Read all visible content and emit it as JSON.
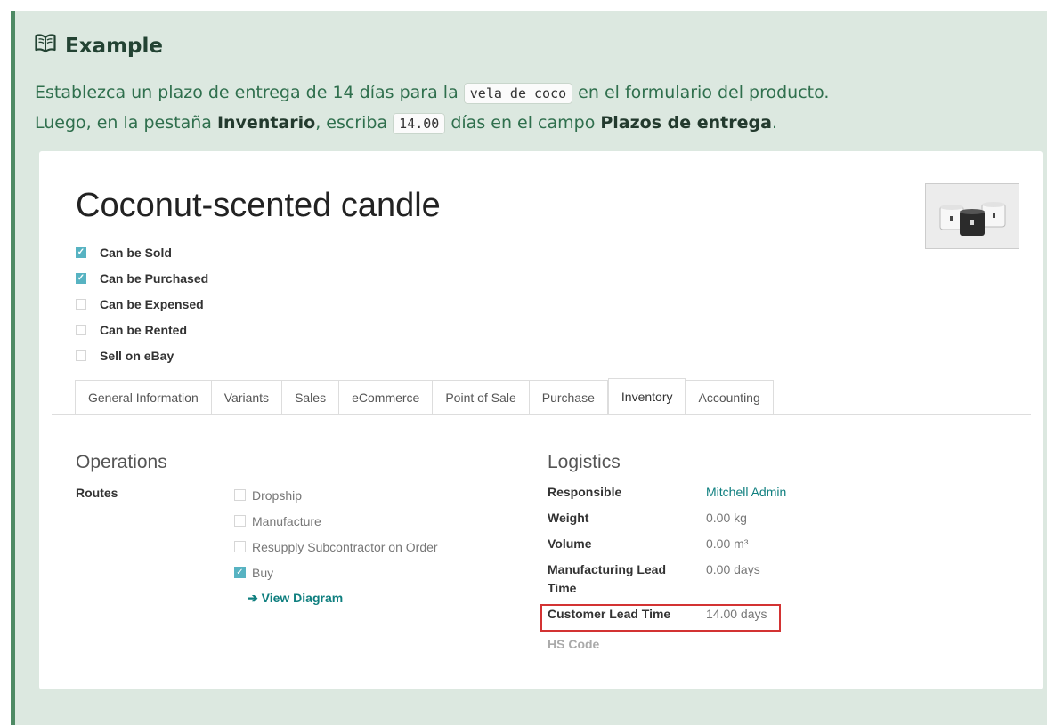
{
  "admonition": {
    "icon": "book-open-icon",
    "title": "Example",
    "line1": {
      "before": "Establezca un plazo de entrega de 14 días para la ",
      "code": "vela de coco",
      "after": " en el formulario del producto."
    },
    "line2": {
      "before": "Luego, en la pestaña ",
      "bold1": "Inventario",
      "mid": ", escriba ",
      "code": "14.00",
      "mid2": " días en el campo ",
      "bold2": "Plazos de entrega",
      "end": "."
    }
  },
  "product": {
    "title": "Coconut-scented candle",
    "image": "candle-product-image",
    "checkboxes": [
      {
        "label": "Can be Sold",
        "checked": true
      },
      {
        "label": "Can be Purchased",
        "checked": true
      },
      {
        "label": "Can be Expensed",
        "checked": false
      },
      {
        "label": "Can be Rented",
        "checked": false
      },
      {
        "label": "Sell on eBay",
        "checked": false
      }
    ]
  },
  "tabs": [
    {
      "label": "General Information",
      "active": false
    },
    {
      "label": "Variants",
      "active": false
    },
    {
      "label": "Sales",
      "active": false
    },
    {
      "label": "eCommerce",
      "active": false
    },
    {
      "label": "Point of Sale",
      "active": false
    },
    {
      "label": "Purchase",
      "active": false
    },
    {
      "label": "Inventory",
      "active": true
    },
    {
      "label": "Accounting",
      "active": false
    }
  ],
  "operations": {
    "title": "Operations",
    "routes_label": "Routes",
    "routes": [
      {
        "label": "Dropship",
        "checked": false
      },
      {
        "label": "Manufacture",
        "checked": false
      },
      {
        "label": "Resupply Subcontractor on Order",
        "checked": false
      },
      {
        "label": "Buy",
        "checked": true
      }
    ],
    "view_diagram": "➔ View Diagram"
  },
  "logistics": {
    "title": "Logistics",
    "responsible_label": "Responsible",
    "responsible_value": "Mitchell Admin",
    "weight_label": "Weight",
    "weight_value": "0.00 kg",
    "volume_label": "Volume",
    "volume_value": "0.00 m³",
    "mfg_label": "Manufacturing Lead Time",
    "mfg_value": "0.00 days",
    "customer_label": "Customer Lead Time",
    "customer_value": "14.00 days",
    "hs_label": "HS Code"
  },
  "colors": {
    "admonition_bg": "#dce8e0",
    "admonition_border": "#4e8a64",
    "checkbox_checked": "#57b3c2",
    "link": "#0f7f7f",
    "highlight": "#d33333"
  }
}
